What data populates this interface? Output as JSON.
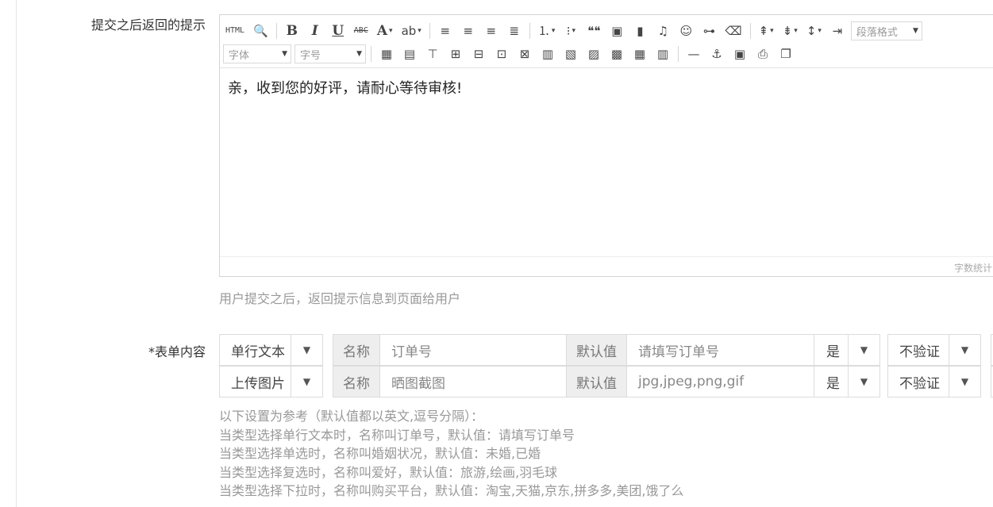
{
  "labels": {
    "reply_tip": "提交之后返回的提示",
    "form_content": "*表单内容"
  },
  "editor": {
    "toolbar_row1": [
      {
        "name": "html-source-icon",
        "glyph": "HTML"
      },
      {
        "name": "preview-icon",
        "glyph": "🔍"
      },
      {
        "name": "bold-icon",
        "glyph": "B"
      },
      {
        "name": "italic-icon",
        "glyph": "I"
      },
      {
        "name": "underline-icon",
        "glyph": "U"
      },
      {
        "name": "strikethrough-icon",
        "glyph": "ABC"
      },
      {
        "name": "font-color-icon",
        "glyph": "A"
      },
      {
        "name": "highlight-icon",
        "glyph": "ab"
      },
      {
        "name": "align-left-icon",
        "glyph": "≡"
      },
      {
        "name": "align-center-icon",
        "glyph": "≡"
      },
      {
        "name": "align-right-icon",
        "glyph": "≡"
      },
      {
        "name": "align-justify-icon",
        "glyph": "≣"
      },
      {
        "name": "ordered-list-icon",
        "glyph": "⒈"
      },
      {
        "name": "unordered-list-icon",
        "glyph": "⁝"
      },
      {
        "name": "blockquote-icon",
        "glyph": "❝❝"
      },
      {
        "name": "image-icon",
        "glyph": "▣"
      },
      {
        "name": "video-icon",
        "glyph": "▮"
      },
      {
        "name": "music-icon",
        "glyph": "♫"
      },
      {
        "name": "emoticon-icon",
        "glyph": "☺"
      },
      {
        "name": "link-icon",
        "glyph": "⊶"
      },
      {
        "name": "eraser-icon",
        "glyph": "⌫"
      },
      {
        "name": "row-spacing-top-icon",
        "glyph": "⇞"
      },
      {
        "name": "row-spacing-bottom-icon",
        "glyph": "⇟"
      },
      {
        "name": "line-height-icon",
        "glyph": "↕"
      },
      {
        "name": "indent-icon",
        "glyph": "⇥"
      }
    ],
    "paragraph_format": "段落格式",
    "font_family": "字体",
    "font_size": "字号",
    "toolbar_row2": [
      {
        "name": "insert-table-icon",
        "glyph": "▦"
      },
      {
        "name": "table-props-icon",
        "glyph": "▤"
      },
      {
        "name": "insert-caption-icon",
        "glyph": "⊤"
      },
      {
        "name": "insert-row-before-icon",
        "glyph": "⊞"
      },
      {
        "name": "insert-row-after-icon",
        "glyph": "⊟"
      },
      {
        "name": "insert-col-before-icon",
        "glyph": "⊡"
      },
      {
        "name": "insert-col-after-icon",
        "glyph": "⊠"
      },
      {
        "name": "merge-cells-icon",
        "glyph": "▥"
      },
      {
        "name": "merge-right-icon",
        "glyph": "▧"
      },
      {
        "name": "merge-down-icon",
        "glyph": "▨"
      },
      {
        "name": "split-cells-icon",
        "glyph": "▩"
      },
      {
        "name": "split-rows-icon",
        "glyph": "▦"
      },
      {
        "name": "split-cols-icon",
        "glyph": "▥"
      },
      {
        "name": "horizontal-rule-icon",
        "glyph": "—"
      },
      {
        "name": "anchor-icon",
        "glyph": "⚓"
      },
      {
        "name": "template-icon",
        "glyph": "▣"
      },
      {
        "name": "print-icon",
        "glyph": "⎙"
      },
      {
        "name": "paste-icon",
        "glyph": "❐"
      }
    ],
    "content": "亲，收到您的好评，请耐心等待审核!",
    "word_count": "字数统计"
  },
  "help": {
    "reply_tip": "用户提交之后，返回提示信息到页面给用户"
  },
  "form_rows": [
    {
      "type": "单行文本",
      "name_label": "名称",
      "name_value": "订单号",
      "default_label": "默认值",
      "default_value": "请填写订单号",
      "required": "是",
      "validate": "不验证"
    },
    {
      "type": "上传图片",
      "name_label": "名称",
      "name_value": "晒图截图",
      "default_label": "默认值",
      "default_value": "jpg,jpeg,png,gif",
      "required": "是",
      "validate": "不验证"
    }
  ],
  "hints": [
    "以下设置为参考（默认值都以英文,逗号分隔）：",
    "当类型选择单行文本时，名称叫订单号，默认值：请填写订单号",
    "当类型选择单选时，名称叫婚姻状况，默认值：未婚,已婚",
    "当类型选择复选时，名称叫爱好，默认值：旅游,绘画,羽毛球",
    "当类型选择下拉时，名称叫购买平台，默认值：淘宝,天猫,京东,拼多多,美团,饿了么"
  ]
}
